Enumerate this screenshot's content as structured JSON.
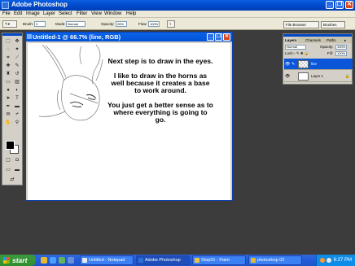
{
  "app": {
    "title": "Adobe Photoshop",
    "window_buttons": {
      "minimize": "_",
      "restore": "❐",
      "close": "✕"
    }
  },
  "menubar": {
    "items": [
      "File",
      "Edit",
      "Image",
      "Layer",
      "Select",
      "Filter",
      "View",
      "Window",
      "Help"
    ]
  },
  "options": {
    "brush_label": "Brush:",
    "brush_size": "3",
    "mode_label": "Mode:",
    "mode_value": "Normal",
    "opacity_label": "Opacity:",
    "opacity_value": "26%",
    "flow_label": "Flow:",
    "flow_value": "100%",
    "palette_well": [
      "File Browser",
      "Brushes"
    ]
  },
  "document": {
    "title": "Untitled-1 @ 66.7% (line, RGB)",
    "note": [
      "Next step is to draw in the eyes.",
      "I like to draw in the horns as well because it creates a base to work around.",
      "You just get a better sense as to where everything is going to go."
    ]
  },
  "layers_panel": {
    "tabs": [
      "Layers",
      "Channels",
      "Paths"
    ],
    "mode": "Normal",
    "opacity_label": "Opacity:",
    "opacity": "100%",
    "lock_label": "Lock:",
    "fill_label": "Fill:",
    "fill": "100%",
    "layers": [
      {
        "name": "line",
        "selected": true
      },
      {
        "name": "Layer 1",
        "selected": false
      }
    ]
  },
  "taskbar": {
    "start_label": "start",
    "buttons": [
      "Untitled - Notepad",
      "Adobe Photoshop",
      "Step01 - Paint",
      "photoshop 02"
    ],
    "active_index": 1,
    "clock": "6:27 PM"
  },
  "colors": {
    "xp_blue": "#0a55d8",
    "start_green": "#3c9a3c",
    "workspace": "#3c3c3c"
  }
}
